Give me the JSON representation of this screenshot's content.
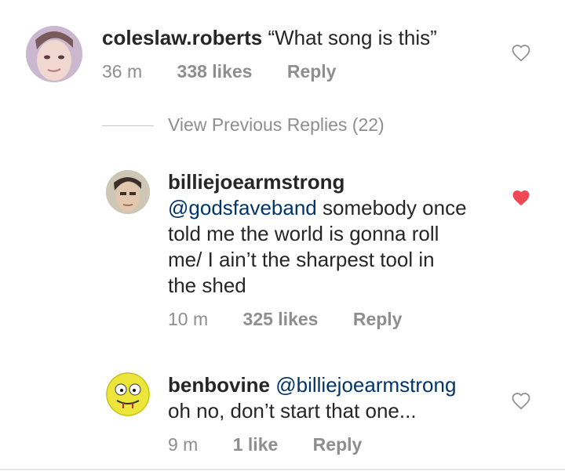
{
  "comments": [
    {
      "username": "coleslaw.roberts",
      "text": "“What song is this”",
      "time": "36 m",
      "likes": "338 likes",
      "reply": "Reply",
      "liked": false
    }
  ],
  "view_previous": "View Previous Replies (22)",
  "replies": [
    {
      "username": "billiejoearmstrong",
      "mention": "@godsfaveband",
      "lines": [
        " somebody once",
        "told me the world is gonna roll",
        "me/ I ain’t the sharpest tool in",
        "the shed"
      ],
      "time": "10 m",
      "likes": "325 likes",
      "reply": "Reply",
      "liked": true
    },
    {
      "username": "benbovine",
      "mention": "@billiejoearmstrong",
      "lines": [
        "oh no, don’t start that one..."
      ],
      "time": "9 m",
      "likes": "1 like",
      "reply": "Reply",
      "liked": false
    }
  ],
  "colors": {
    "text": "#262626",
    "muted": "#8e8e8e",
    "mention": "#003569",
    "heart_liked": "#ed4956",
    "heart_outline": "#8e8e8e"
  }
}
